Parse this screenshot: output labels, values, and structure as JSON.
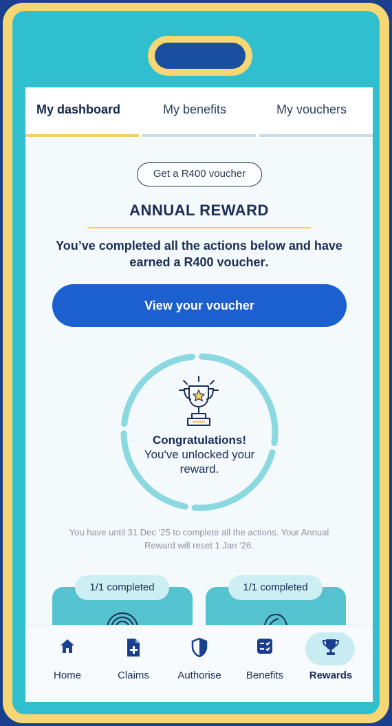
{
  "tabs": [
    {
      "label": "My dashboard",
      "active": true
    },
    {
      "label": "My benefits",
      "active": false
    },
    {
      "label": "My vouchers",
      "active": false
    }
  ],
  "voucher_pill": "Get a R400 voucher",
  "section_title": "ANNUAL REWARD",
  "summary": {
    "line": "You’ve completed all the actions below and have earned a",
    "emphasis": "R400 voucher",
    "end": "."
  },
  "cta_label": "View your voucher",
  "progress": {
    "fraction_complete": 1.0,
    "title": "Congratulations!",
    "message": "You've unlocked your reward."
  },
  "deadline_text": "You have until 31 Dec ‘25 to complete all the actions. Your Annual Reward will reset 1 Jan ‘26.",
  "action_cards": [
    {
      "badge": "1/1 completed",
      "icon": "fingerprint-icon"
    },
    {
      "badge": "1/1 completed",
      "icon": "profile-icon"
    }
  ],
  "bottom_nav": [
    {
      "label": "Home",
      "icon": "home-icon",
      "active": false
    },
    {
      "label": "Claims",
      "icon": "claims-document-icon",
      "active": false
    },
    {
      "label": "Authorise",
      "icon": "shield-icon",
      "active": false
    },
    {
      "label": "Benefits",
      "icon": "benefits-checklist-icon",
      "active": false
    },
    {
      "label": "Rewards",
      "icon": "trophy-icon",
      "active": true
    }
  ],
  "colors": {
    "brand_blue": "#1c5fcf",
    "accent_yellow": "#f3cf67",
    "teal": "#55c2cf",
    "ring": "#8ad8e0",
    "dark_text": "#1b2d55"
  }
}
